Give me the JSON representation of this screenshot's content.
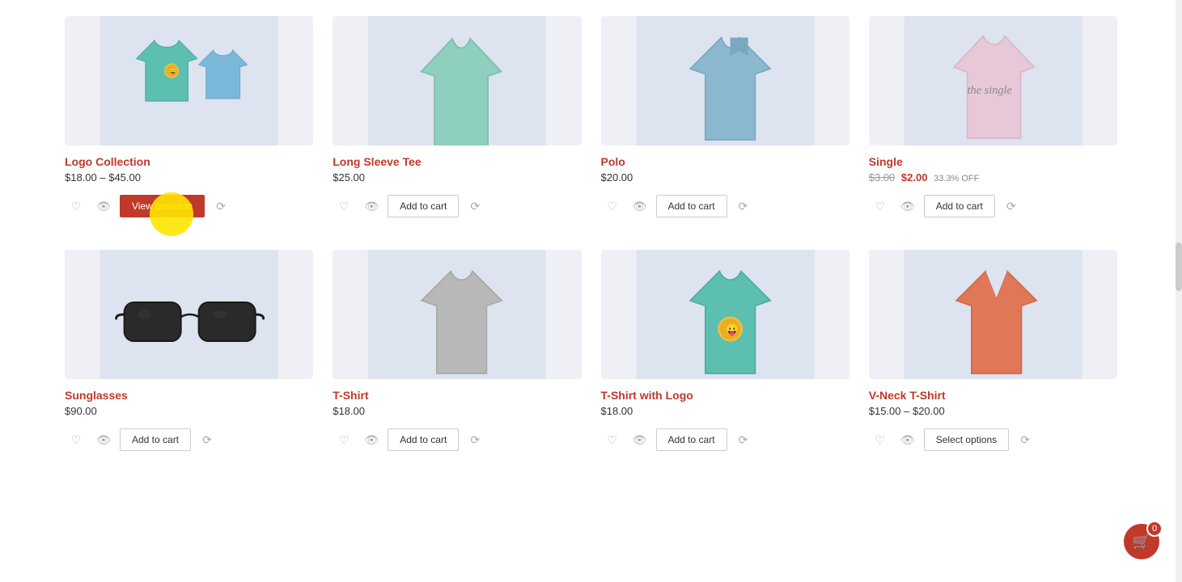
{
  "products_row1": [
    {
      "id": "logo-collection",
      "title": "Logo Collection",
      "price_display": "$18.00 – $45.00",
      "price_type": "range",
      "action_label": "View products",
      "action_type": "view"
    },
    {
      "id": "long-sleeve-tee",
      "title": "Long Sleeve Tee",
      "price_display": "$25.00",
      "price_type": "single",
      "action_label": "Add to cart",
      "action_type": "cart"
    },
    {
      "id": "polo",
      "title": "Polo",
      "price_display": "$20.00",
      "price_type": "single",
      "action_label": "Add to cart",
      "action_type": "cart"
    },
    {
      "id": "single",
      "title": "Single",
      "price_original": "$3.00",
      "price_sale": "$2.00",
      "price_off": "33.3% OFF",
      "price_type": "sale",
      "action_label": "Add to cart",
      "action_type": "cart"
    }
  ],
  "products_row2": [
    {
      "id": "sunglasses",
      "title": "Sunglasses",
      "price_display": "$90.00",
      "price_type": "single",
      "action_label": "Add to cart",
      "action_type": "cart"
    },
    {
      "id": "t-shirt",
      "title": "T-Shirt",
      "price_display": "$18.00",
      "price_type": "single",
      "action_label": "Add to cart",
      "action_type": "cart"
    },
    {
      "id": "t-shirt-with-logo",
      "title": "T-Shirt with Logo",
      "price_display": "$18.00",
      "price_type": "single",
      "action_label": "Add to cart",
      "action_type": "cart"
    },
    {
      "id": "v-neck-t-shirt",
      "title": "V-Neck T-Shirt",
      "price_display": "$15.00 – $20.00",
      "price_type": "range",
      "action_label": "Select options",
      "action_type": "select"
    }
  ],
  "cart": {
    "count": "0"
  }
}
